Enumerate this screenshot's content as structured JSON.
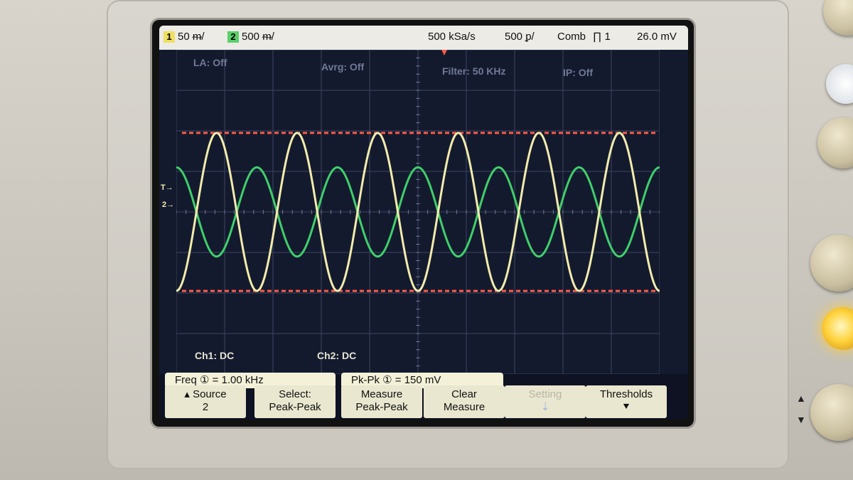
{
  "status_bar": {
    "ch1_num": "1",
    "ch1_scale": "50 ᵯ/",
    "ch2_num": "2",
    "ch2_scale": "500 ᵯ/",
    "sample_rate": "500 kSa/s",
    "timebase": "500 ᵱ/",
    "trigger_mode": "Comb",
    "trigger_source": "∏ 1",
    "trigger_level": "26.0 mV"
  },
  "overlay": {
    "la": "LA: Off",
    "avg": "Avrg: Off",
    "filter": "Filter: 50 KHz",
    "ip": "IP: Off",
    "ch1_coupling": "Ch1: DC",
    "ch2_coupling": "Ch2: DC"
  },
  "measurements": {
    "freq": "Freq ① = 1.00 kHz",
    "pkpk": "Pk-Pk ① = 150 mV"
  },
  "softkeys": [
    {
      "line1": "▴ Source",
      "line2": "2"
    },
    {
      "line1": "Select:",
      "line2": "Peak-Peak"
    },
    {
      "line1": "Measure",
      "line2": "Peak-Peak"
    },
    {
      "line1": "Clear",
      "line2": "Measure"
    },
    {
      "line1": "Setting",
      "line2": "⇣"
    },
    {
      "line1": "Thresholds",
      "line2": "⯆"
    }
  ],
  "colors": {
    "ch1": "#f2ecac",
    "ch2": "#3fcf6a",
    "cursor": "#ff5a4a",
    "grid": "#3a4560"
  },
  "chart_data": {
    "type": "line",
    "series": [
      {
        "cycles": 6.0,
        "peak_to_peak_divisions": 3.9,
        "phase_deg": 180
      },
      {
        "cycles": 6.0,
        "peak_to_peak_divisions": 2.2,
        "phase_deg": 0
      }
    ],
    "grid": {
      "x_divisions": 10,
      "y_divisions": 8
    },
    "cursor_lines": [
      1.95,
      -1.95
    ]
  }
}
